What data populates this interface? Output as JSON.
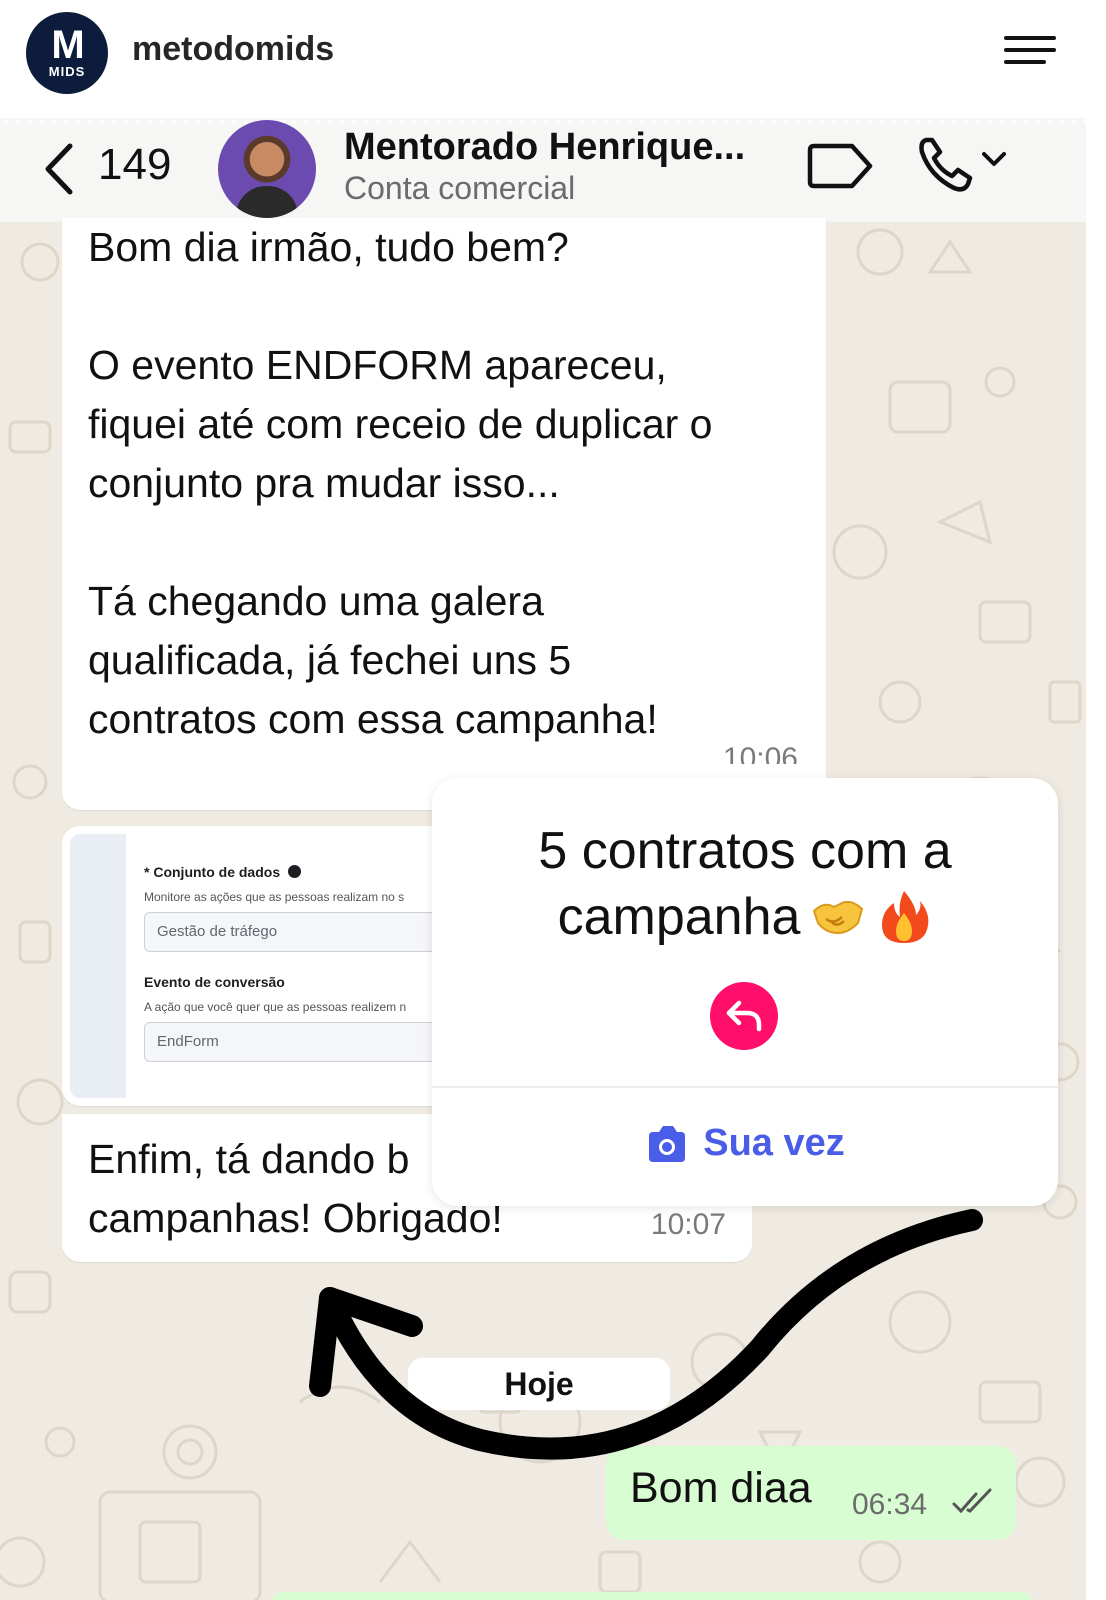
{
  "instagram": {
    "avatar_mark": "M",
    "avatar_text": "MIDS",
    "username": "metodomids",
    "menu_icon": "hamburger-menu-icon"
  },
  "chat_header": {
    "back_count": "149",
    "contact_name": "Mentorado Henrique...",
    "contact_subtitle": "Conta comercial"
  },
  "messages": {
    "msg1": {
      "text": "Bom dia irmão, tudo bem?\n\nO evento ENDFORM apareceu,\nfiquei até com receio de duplicar o\nconjunto pra mudar isso...\n\nTá chegando uma galera\nqualificada, já fechei uns 5\ncontratos com essa campanha!",
      "time": "10:06"
    },
    "image_form": {
      "dataset_label": "* Conjunto de dados",
      "dataset_desc": "Monitore as ações que as pessoas realizam no s",
      "dataset_value": "Gestão de tráfego",
      "event_label": "Evento de conversão",
      "event_desc": "A ação que você quer que as pessoas realizem n",
      "event_value": "EndForm"
    },
    "msg3": {
      "text": "Enfim, tá dando b\ncampanhas! Obrigado!",
      "time": "10:07"
    },
    "date_separator": "Hoje",
    "outgoing": {
      "text": "Bom diaa",
      "time": "06:34"
    }
  },
  "story_reply": {
    "line1": "5 contratos com a",
    "line2": "campanha",
    "emojis": [
      "handshake-emoji",
      "fire-emoji"
    ],
    "action_label": "Sua vez"
  },
  "colors": {
    "chat_bg": "#efeae2",
    "outgoing_bubble": "#d9fdd3",
    "reply_button": "#ff0f6a",
    "sua_vez": "#4a5de8",
    "brand_navy": "#0d1b3d"
  }
}
